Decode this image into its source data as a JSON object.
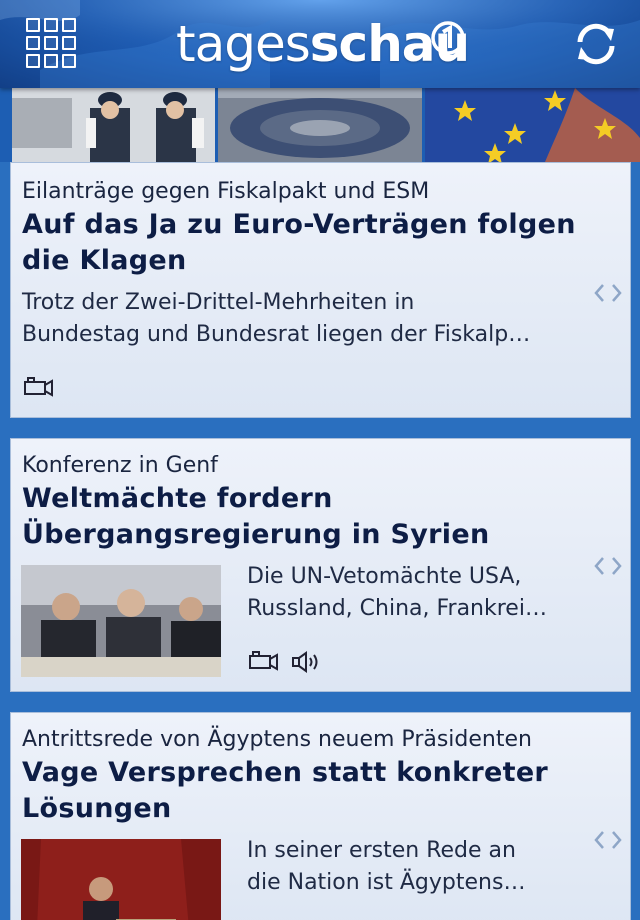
{
  "header": {
    "logo_light": "tages",
    "logo_bold": "schau",
    "menu_icon": "grid-icon",
    "refresh_icon": "refresh-icon"
  },
  "articles": [
    {
      "kicker": "Eilanträge gegen Fiskalpakt und ESM",
      "headline_line1": "Auf das Ja zu Euro-Verträgen folgen",
      "headline_line2": "die Klagen",
      "teaser_line1": "Trotz der Zwei-Drittel-Mehrheiten in",
      "teaser_line2": "Bundestag und Bundesrat liegen der Fiskalp…",
      "media": [
        "video-icon"
      ]
    },
    {
      "kicker": "Konferenz in Genf",
      "headline_line1": "Weltmächte fordern",
      "headline_line2": "Übergangsregierung in Syrien",
      "teaser_line1": "Die UN-Vetomächte USA,",
      "teaser_line2": "Russland, China, Frankrei…",
      "media": [
        "video-icon",
        "audio-icon"
      ]
    },
    {
      "kicker": "Antrittsrede von Ägyptens neuem Präsidenten",
      "headline_line1": "Vage Versprechen statt konkreter",
      "headline_line2": "Lösungen",
      "teaser_line1": "In seiner ersten Rede an",
      "teaser_line2": "die Nation ist Ägyptens…"
    }
  ],
  "colors": {
    "header_blue": "#1f5fb8",
    "background_blue": "#2a6fbf",
    "headline": "#0d1d45",
    "card_bg": "#e4ebf6"
  }
}
